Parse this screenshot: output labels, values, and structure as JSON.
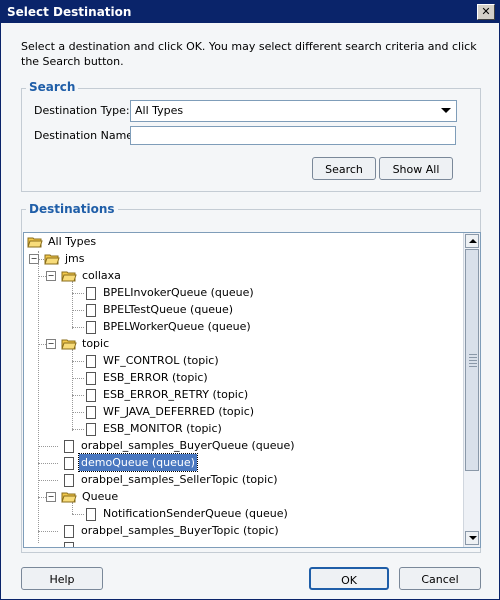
{
  "window": {
    "title": "Select Destination",
    "close_glyph": "✕"
  },
  "instructions": "Select a destination and click OK. You may select different search criteria and click the Search button.",
  "search": {
    "group_title": "Search",
    "type_label": "Destination Type:",
    "type_value": "All Types",
    "name_label": "Destination Name:",
    "name_value": "",
    "search_button": "Search",
    "show_all_button": "Show All"
  },
  "destinations": {
    "group_title": "Destinations",
    "tree": {
      "root": "All Types",
      "jms": "jms",
      "collaxa": "collaxa",
      "collaxa_items": [
        "BPELInvokerQueue (queue)",
        "BPELTestQueue (queue)",
        "BPELWorkerQueue (queue)"
      ],
      "topic": "topic",
      "topic_items": [
        "WF_CONTROL (topic)",
        "ESB_ERROR (topic)",
        "ESB_ERROR_RETRY (topic)",
        "WF_JAVA_DEFERRED (topic)",
        "ESB_MONITOR (topic)"
      ],
      "buyer_queue": "orabpel_samples_BuyerQueue (queue)",
      "demo_queue": "demoQueue (queue)",
      "seller_topic": "orabpel_samples_SellerTopic (topic)",
      "queue": "Queue",
      "notification": "NotificationSenderQueue (queue)",
      "buyer_topic": "orabpel_samples_BuyerTopic (topic)"
    },
    "selected": "demoQueue (queue)"
  },
  "footer": {
    "help_button": "Help",
    "ok_button": "OK",
    "cancel_button": "Cancel"
  },
  "colors": {
    "title_bar": "#0a246a",
    "group_title": "#1f5ea8",
    "selection": "#4a78c0",
    "folder": "#f2c84b"
  }
}
